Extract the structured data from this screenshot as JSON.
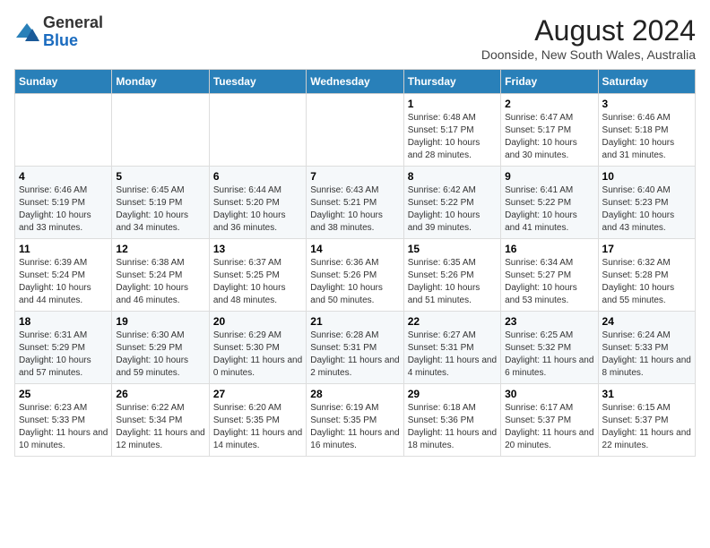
{
  "header": {
    "logo_general": "General",
    "logo_blue": "Blue",
    "month_year": "August 2024",
    "location": "Doonside, New South Wales, Australia"
  },
  "weekdays": [
    "Sunday",
    "Monday",
    "Tuesday",
    "Wednesday",
    "Thursday",
    "Friday",
    "Saturday"
  ],
  "weeks": [
    [
      {
        "day": "",
        "sunrise": "",
        "sunset": "",
        "daylight": ""
      },
      {
        "day": "",
        "sunrise": "",
        "sunset": "",
        "daylight": ""
      },
      {
        "day": "",
        "sunrise": "",
        "sunset": "",
        "daylight": ""
      },
      {
        "day": "",
        "sunrise": "",
        "sunset": "",
        "daylight": ""
      },
      {
        "day": "1",
        "sunrise": "Sunrise: 6:48 AM",
        "sunset": "Sunset: 5:17 PM",
        "daylight": "Daylight: 10 hours and 28 minutes."
      },
      {
        "day": "2",
        "sunrise": "Sunrise: 6:47 AM",
        "sunset": "Sunset: 5:17 PM",
        "daylight": "Daylight: 10 hours and 30 minutes."
      },
      {
        "day": "3",
        "sunrise": "Sunrise: 6:46 AM",
        "sunset": "Sunset: 5:18 PM",
        "daylight": "Daylight: 10 hours and 31 minutes."
      }
    ],
    [
      {
        "day": "4",
        "sunrise": "Sunrise: 6:46 AM",
        "sunset": "Sunset: 5:19 PM",
        "daylight": "Daylight: 10 hours and 33 minutes."
      },
      {
        "day": "5",
        "sunrise": "Sunrise: 6:45 AM",
        "sunset": "Sunset: 5:19 PM",
        "daylight": "Daylight: 10 hours and 34 minutes."
      },
      {
        "day": "6",
        "sunrise": "Sunrise: 6:44 AM",
        "sunset": "Sunset: 5:20 PM",
        "daylight": "Daylight: 10 hours and 36 minutes."
      },
      {
        "day": "7",
        "sunrise": "Sunrise: 6:43 AM",
        "sunset": "Sunset: 5:21 PM",
        "daylight": "Daylight: 10 hours and 38 minutes."
      },
      {
        "day": "8",
        "sunrise": "Sunrise: 6:42 AM",
        "sunset": "Sunset: 5:22 PM",
        "daylight": "Daylight: 10 hours and 39 minutes."
      },
      {
        "day": "9",
        "sunrise": "Sunrise: 6:41 AM",
        "sunset": "Sunset: 5:22 PM",
        "daylight": "Daylight: 10 hours and 41 minutes."
      },
      {
        "day": "10",
        "sunrise": "Sunrise: 6:40 AM",
        "sunset": "Sunset: 5:23 PM",
        "daylight": "Daylight: 10 hours and 43 minutes."
      }
    ],
    [
      {
        "day": "11",
        "sunrise": "Sunrise: 6:39 AM",
        "sunset": "Sunset: 5:24 PM",
        "daylight": "Daylight: 10 hours and 44 minutes."
      },
      {
        "day": "12",
        "sunrise": "Sunrise: 6:38 AM",
        "sunset": "Sunset: 5:24 PM",
        "daylight": "Daylight: 10 hours and 46 minutes."
      },
      {
        "day": "13",
        "sunrise": "Sunrise: 6:37 AM",
        "sunset": "Sunset: 5:25 PM",
        "daylight": "Daylight: 10 hours and 48 minutes."
      },
      {
        "day": "14",
        "sunrise": "Sunrise: 6:36 AM",
        "sunset": "Sunset: 5:26 PM",
        "daylight": "Daylight: 10 hours and 50 minutes."
      },
      {
        "day": "15",
        "sunrise": "Sunrise: 6:35 AM",
        "sunset": "Sunset: 5:26 PM",
        "daylight": "Daylight: 10 hours and 51 minutes."
      },
      {
        "day": "16",
        "sunrise": "Sunrise: 6:34 AM",
        "sunset": "Sunset: 5:27 PM",
        "daylight": "Daylight: 10 hours and 53 minutes."
      },
      {
        "day": "17",
        "sunrise": "Sunrise: 6:32 AM",
        "sunset": "Sunset: 5:28 PM",
        "daylight": "Daylight: 10 hours and 55 minutes."
      }
    ],
    [
      {
        "day": "18",
        "sunrise": "Sunrise: 6:31 AM",
        "sunset": "Sunset: 5:29 PM",
        "daylight": "Daylight: 10 hours and 57 minutes."
      },
      {
        "day": "19",
        "sunrise": "Sunrise: 6:30 AM",
        "sunset": "Sunset: 5:29 PM",
        "daylight": "Daylight: 10 hours and 59 minutes."
      },
      {
        "day": "20",
        "sunrise": "Sunrise: 6:29 AM",
        "sunset": "Sunset: 5:30 PM",
        "daylight": "Daylight: 11 hours and 0 minutes."
      },
      {
        "day": "21",
        "sunrise": "Sunrise: 6:28 AM",
        "sunset": "Sunset: 5:31 PM",
        "daylight": "Daylight: 11 hours and 2 minutes."
      },
      {
        "day": "22",
        "sunrise": "Sunrise: 6:27 AM",
        "sunset": "Sunset: 5:31 PM",
        "daylight": "Daylight: 11 hours and 4 minutes."
      },
      {
        "day": "23",
        "sunrise": "Sunrise: 6:25 AM",
        "sunset": "Sunset: 5:32 PM",
        "daylight": "Daylight: 11 hours and 6 minutes."
      },
      {
        "day": "24",
        "sunrise": "Sunrise: 6:24 AM",
        "sunset": "Sunset: 5:33 PM",
        "daylight": "Daylight: 11 hours and 8 minutes."
      }
    ],
    [
      {
        "day": "25",
        "sunrise": "Sunrise: 6:23 AM",
        "sunset": "Sunset: 5:33 PM",
        "daylight": "Daylight: 11 hours and 10 minutes."
      },
      {
        "day": "26",
        "sunrise": "Sunrise: 6:22 AM",
        "sunset": "Sunset: 5:34 PM",
        "daylight": "Daylight: 11 hours and 12 minutes."
      },
      {
        "day": "27",
        "sunrise": "Sunrise: 6:20 AM",
        "sunset": "Sunset: 5:35 PM",
        "daylight": "Daylight: 11 hours and 14 minutes."
      },
      {
        "day": "28",
        "sunrise": "Sunrise: 6:19 AM",
        "sunset": "Sunset: 5:35 PM",
        "daylight": "Daylight: 11 hours and 16 minutes."
      },
      {
        "day": "29",
        "sunrise": "Sunrise: 6:18 AM",
        "sunset": "Sunset: 5:36 PM",
        "daylight": "Daylight: 11 hours and 18 minutes."
      },
      {
        "day": "30",
        "sunrise": "Sunrise: 6:17 AM",
        "sunset": "Sunset: 5:37 PM",
        "daylight": "Daylight: 11 hours and 20 minutes."
      },
      {
        "day": "31",
        "sunrise": "Sunrise: 6:15 AM",
        "sunset": "Sunset: 5:37 PM",
        "daylight": "Daylight: 11 hours and 22 minutes."
      }
    ]
  ]
}
